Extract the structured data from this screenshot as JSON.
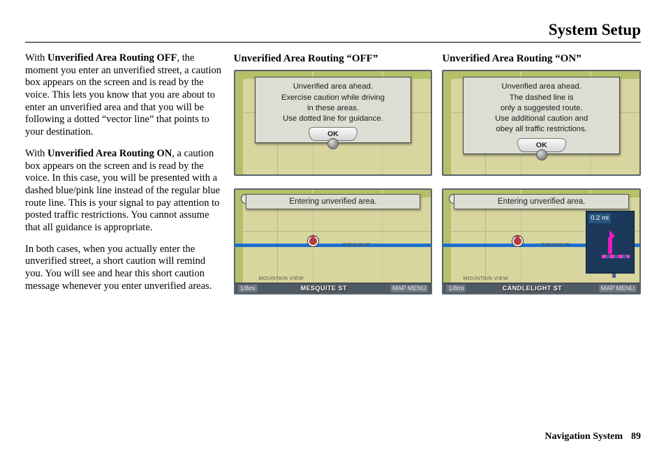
{
  "page_title": "System Setup",
  "footer": {
    "label": "Navigation System",
    "page": "89"
  },
  "col1": {
    "p1_prefix": "With ",
    "p1_bold": "Unverified Area Routing OFF",
    "p1_rest": ", the moment you enter an unverified street, a caution box appears on the screen and is read by the voice. This lets you know that you are about to enter an unverified area and that you will be following a dotted “vector line” that points to your destination.",
    "p2_prefix": "With ",
    "p2_bold": "Unverified Area Routing ON",
    "p2_rest": ", a caution box appears on the screen and is read by the voice. In this case, you will be presented with a dashed blue/pink line instead of the regular blue route line. This is your signal to pay attention to posted traffic restrictions. You cannot assume that all guidance is appropriate.",
    "p3": "In both cases, when you actually enter the unverified street, a short caution will remind you. You will see and hear this short caution message whenever you enter unverified areas."
  },
  "off": {
    "heading": "Unverified Area Routing “OFF”",
    "caution": {
      "l1": "Unverified area ahead.",
      "l2": "Exercise caution while driving",
      "l3": "in these areas.",
      "l4": "Use dotted line for guidance."
    },
    "ok": "OK",
    "banner": "Entering unverified area.",
    "scale": "1/8mi",
    "street": "MESQUITE ST",
    "menu": "MAP MENU",
    "label_roundup": "ROUNDUP",
    "label_mtview": "MOUNTAIN VIEW"
  },
  "on": {
    "heading": "Unverified Area Routing “ON”",
    "caution": {
      "l1": "Unverified area ahead.",
      "l2": "The dashed line is",
      "l3": "only a suggested route.",
      "l4": "Use additional caution and",
      "l5": "obey all traffic restrictions."
    },
    "ok": "OK",
    "banner": "Entering unverified area.",
    "scale": "1/8mi",
    "street": "CANDLELIGHT ST",
    "menu": "MAP MENU",
    "turn_distance": "0.2 mi",
    "label_roundup": "ROUNDUP",
    "label_mtview": "MOUNTAIN VIEW"
  }
}
